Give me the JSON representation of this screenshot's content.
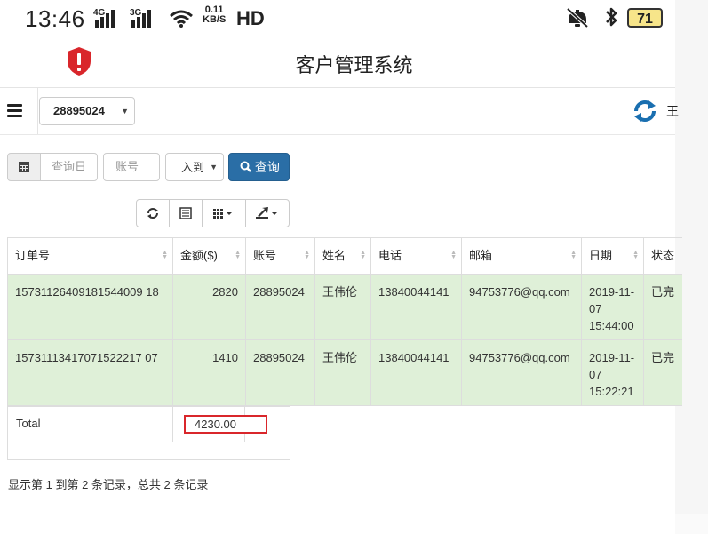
{
  "status_bar": {
    "time": "13:46",
    "signal1_label": "4G",
    "signal2_label": "3G",
    "speed_value": "0.11",
    "speed_unit": "KB/S",
    "hd_label": "HD",
    "battery_level": "71"
  },
  "app": {
    "title": "客户管理系统"
  },
  "toolbar": {
    "account_selected": "28895024",
    "user_name": "王"
  },
  "search": {
    "date_placeholder": "查询日",
    "account_placeholder": "账号",
    "type_value": "入到",
    "query_label": "查询"
  },
  "table": {
    "columns": [
      "订单号",
      "金额($)",
      "账号",
      "姓名",
      "电话",
      "邮箱",
      "日期",
      "状态"
    ],
    "rows": [
      {
        "order_no": "15731126409181544009 18",
        "amount": "2820",
        "account": "28895024",
        "name": "王伟伦",
        "phone": "13840044141",
        "email": "94753776@qq.com",
        "date": "2019-11-07 15:44:00",
        "status": "已完"
      },
      {
        "order_no": "15731113417071522217 07",
        "amount": "1410",
        "account": "28895024",
        "name": "王伟伦",
        "phone": "13840044141",
        "email": "94753776@qq.com",
        "date": "2019-11-07 15:22:21",
        "status": "已完"
      }
    ]
  },
  "footer": {
    "total_label": "Total",
    "total_value": "4230.00"
  },
  "pagination": {
    "info": "显示第 1 到第 2 条记录，总共 2 条记录"
  },
  "colors": {
    "row_highlight": "#dff0d8",
    "primary_button": "#2a6ea6",
    "brand_shield": "#d9262b",
    "annotation_box": "#d9262b",
    "refresh_icon": "#1a6fb0"
  }
}
